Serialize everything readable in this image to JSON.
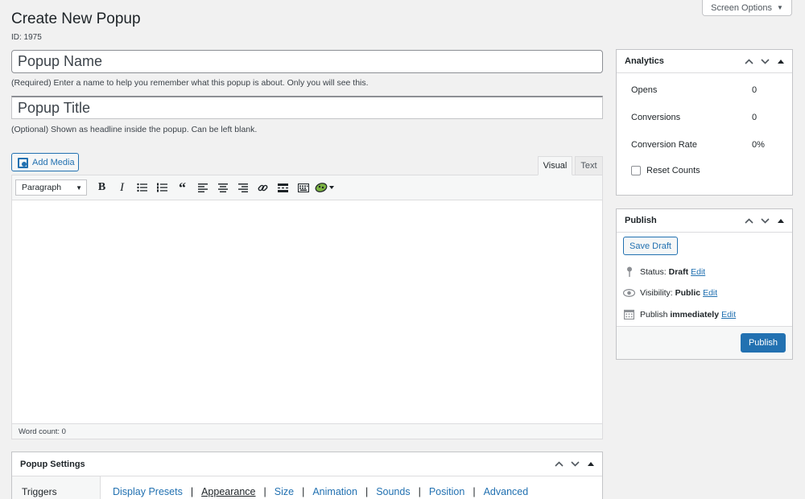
{
  "header": {
    "screen_options": "Screen Options",
    "title": "Create New Popup",
    "id_text": "ID: 1975"
  },
  "popup_name": {
    "value": "Popup Name",
    "help": "(Required) Enter a name to help you remember what this popup is about. Only you will see this."
  },
  "popup_title": {
    "value": "Popup Title",
    "help": "(Optional) Shown as headline inside the popup. Can be left blank."
  },
  "editor": {
    "add_media": "Add Media",
    "tabs": {
      "visual": "Visual",
      "text": "Text"
    },
    "format": "Paragraph",
    "word_count": "Word count: 0",
    "toolbar_icons": [
      "bold-icon",
      "italic-icon",
      "bullet-list-icon",
      "numbered-list-icon",
      "blockquote-icon",
      "align-left-icon",
      "align-center-icon",
      "align-right-icon",
      "link-icon",
      "read-more-icon",
      "toolbar-toggle-icon",
      "popup-maker-icon"
    ]
  },
  "analytics": {
    "title": "Analytics",
    "rows": [
      {
        "label": "Opens",
        "value": "0"
      },
      {
        "label": "Conversions",
        "value": "0"
      },
      {
        "label": "Conversion Rate",
        "value": "0%"
      }
    ],
    "reset_label": "Reset Counts"
  },
  "publish": {
    "title": "Publish",
    "save_draft": "Save Draft",
    "status_label": "Status:",
    "status_value": "Draft",
    "visibility_label": "Visibility:",
    "visibility_value": "Public",
    "publish_label": "Publish",
    "publish_value": "immediately",
    "edit": "Edit",
    "publish_button": "Publish"
  },
  "popup_settings": {
    "title": "Popup Settings",
    "nav_first": "Triggers",
    "tabs": [
      "Display Presets",
      "Appearance",
      "Size",
      "Animation",
      "Sounds",
      "Position",
      "Advanced"
    ],
    "active_tab": "Appearance"
  },
  "colors": {
    "accent": "#2271b1",
    "background": "#f1f1f1",
    "border": "#c3c4c7"
  }
}
